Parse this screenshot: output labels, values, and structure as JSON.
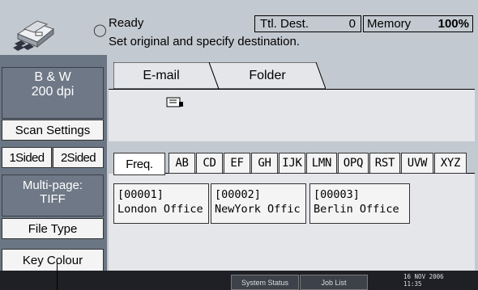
{
  "status": {
    "state": "Ready",
    "message": "Set original and specify destination.",
    "total_dest_label": "Ttl. Dest.",
    "total_dest_value": "0",
    "memory_label": "Memory",
    "memory_value": "100%"
  },
  "left_panel": {
    "mode_line1": "B & W",
    "mode_line2": "200 dpi",
    "scan_settings": "Scan Settings",
    "sided_1": "1Sided",
    "sided_2": "2Sided",
    "file_type_line1": "Multi-page:",
    "file_type_line2": "TIFF",
    "file_type_button": "File Type",
    "key_colour": "Key Colour"
  },
  "tabs": [
    {
      "label": "E-mail"
    },
    {
      "label": "Folder"
    }
  ],
  "index_tabs": [
    "Freq.",
    "AB",
    "CD",
    "EF",
    "GH",
    "IJK",
    "LMN",
    "OPQ",
    "RST",
    "UVW",
    "XYZ"
  ],
  "destinations": [
    {
      "id": "[00001]",
      "name": "London Office"
    },
    {
      "id": "[00002]",
      "name": "NewYork Offic"
    },
    {
      "id": "[00003]",
      "name": "Berlin Office"
    }
  ],
  "bottom": {
    "system_status": "System Status",
    "job_list": "Job List",
    "date": "16 NOV  2006",
    "time": "11:35"
  },
  "icons": [
    "machine-logo-icon",
    "spinner-icon",
    "envelope-icon"
  ]
}
